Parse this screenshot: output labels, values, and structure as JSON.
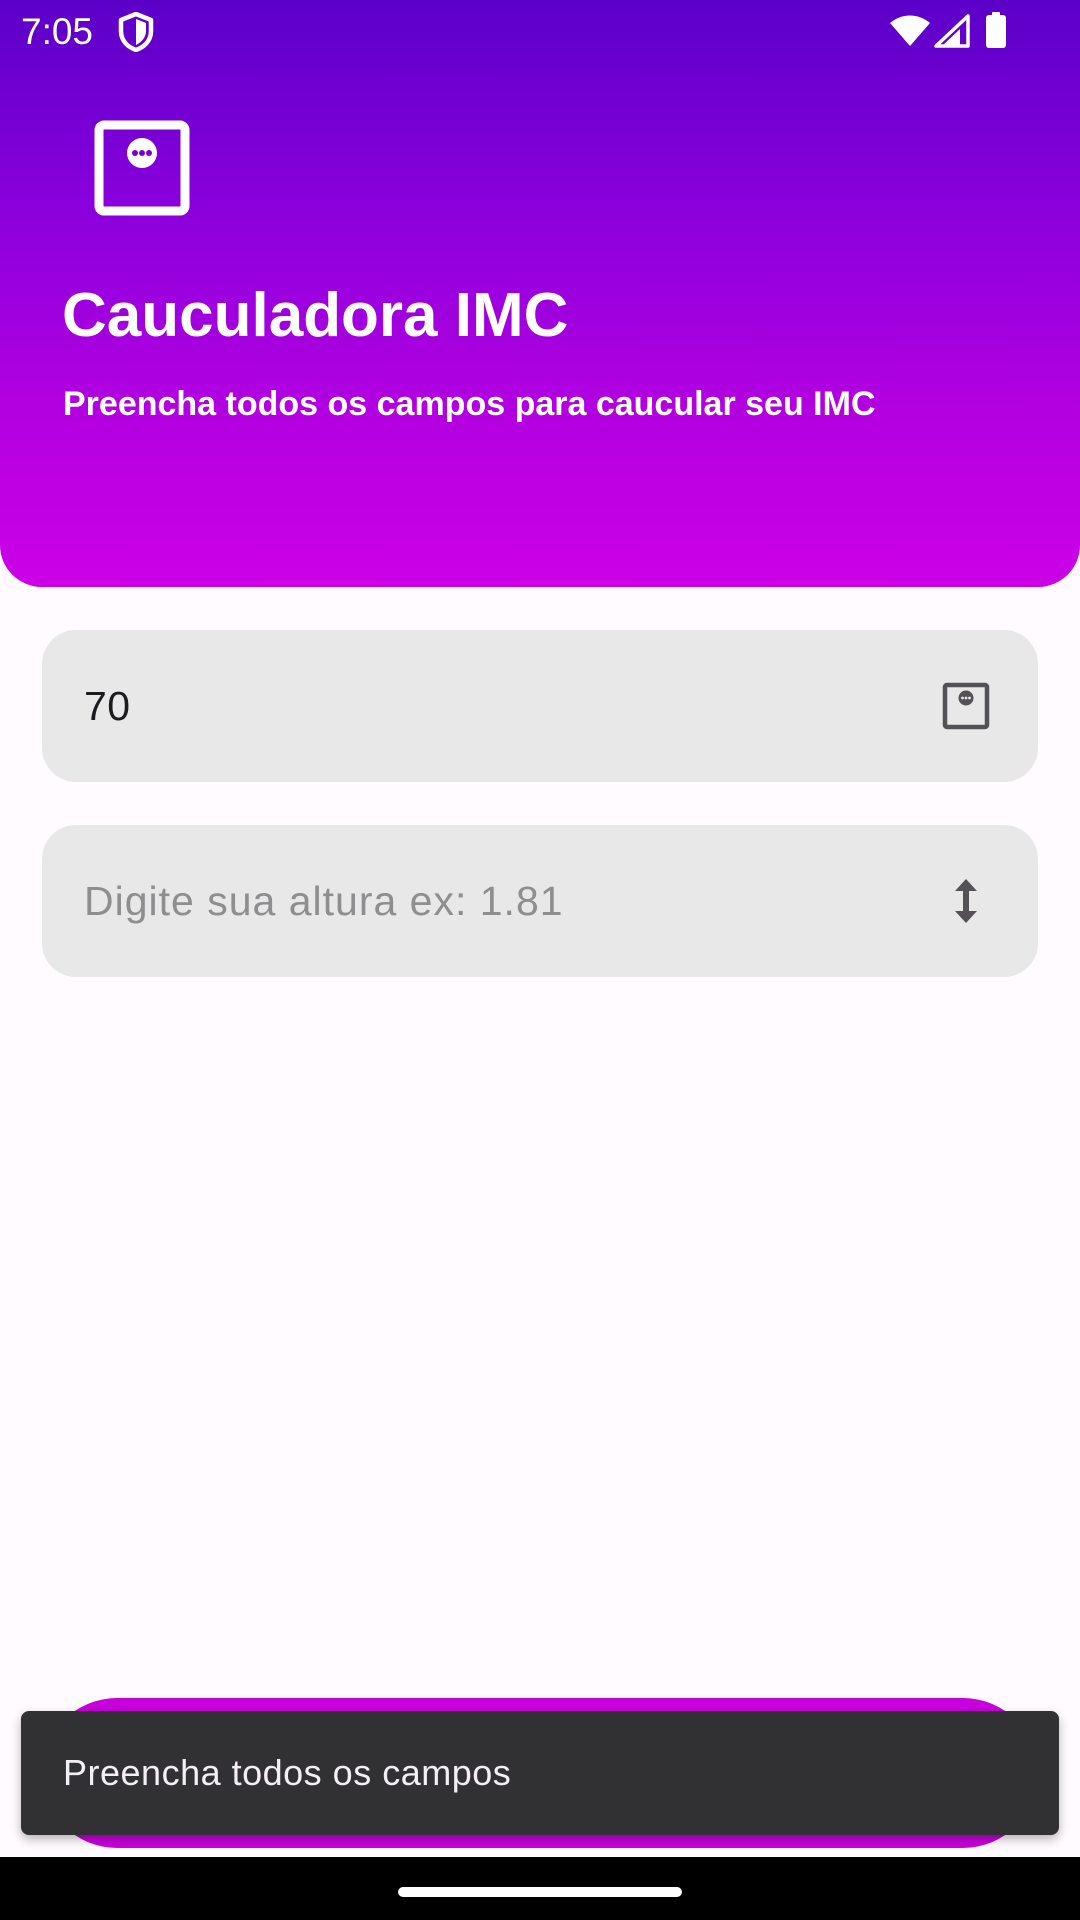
{
  "status_bar": {
    "time": "7:05",
    "icons": [
      "shield-icon",
      "wifi-icon",
      "signal-icon",
      "battery-icon"
    ]
  },
  "header": {
    "icon": "scale-icon",
    "title": "Cauculadora IMC",
    "subtitle": "Preencha todos os campos para caucular seu IMC",
    "gradient_colors": [
      "#5B00C8",
      "#CC00E6"
    ]
  },
  "form": {
    "weight": {
      "value": "70",
      "icon": "scale-icon"
    },
    "height": {
      "value": "",
      "placeholder": "Digite sua altura ex: 1.81",
      "icon": "vertical-arrows-icon"
    }
  },
  "button": {
    "color": "#C800DC"
  },
  "snackbar": {
    "message": "Preencha todos os campos"
  }
}
